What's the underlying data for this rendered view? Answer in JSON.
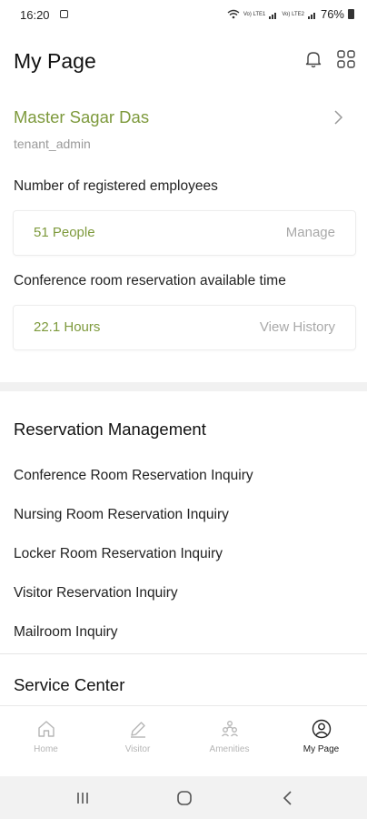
{
  "status_bar": {
    "time": "16:20",
    "battery": "76%",
    "signal_1": "Vo) LTE1",
    "signal_2": "Vo) LTE2"
  },
  "header": {
    "title": "My Page",
    "icons": [
      "bell-icon",
      "grid-icon"
    ]
  },
  "profile": {
    "name": "Master Sagar Das",
    "role": "tenant_admin"
  },
  "employees": {
    "label": "Number of registered employees",
    "value": "51 People",
    "action": "Manage"
  },
  "conference": {
    "label": "Conference room reservation available time",
    "value": "22.1 Hours",
    "action": "View History"
  },
  "reservation_management": {
    "title": "Reservation Management",
    "items": [
      "Conference Room Reservation Inquiry",
      "Nursing Room Reservation Inquiry",
      "Locker Room Reservation Inquiry",
      "Visitor Reservation Inquiry",
      "Mailroom Inquiry"
    ]
  },
  "service_center": {
    "title": "Service Center"
  },
  "bottom_nav": {
    "items": [
      {
        "label": "Home",
        "icon": "home-icon",
        "active": false
      },
      {
        "label": "Visitor",
        "icon": "pencil-icon",
        "active": false
      },
      {
        "label": "Amenities",
        "icon": "amenities-icon",
        "active": false
      },
      {
        "label": "My Page",
        "icon": "user-icon",
        "active": true
      }
    ]
  },
  "colors": {
    "accent": "#7e9a3d",
    "muted": "#a9a9a9",
    "band": "#f1f1f1"
  }
}
